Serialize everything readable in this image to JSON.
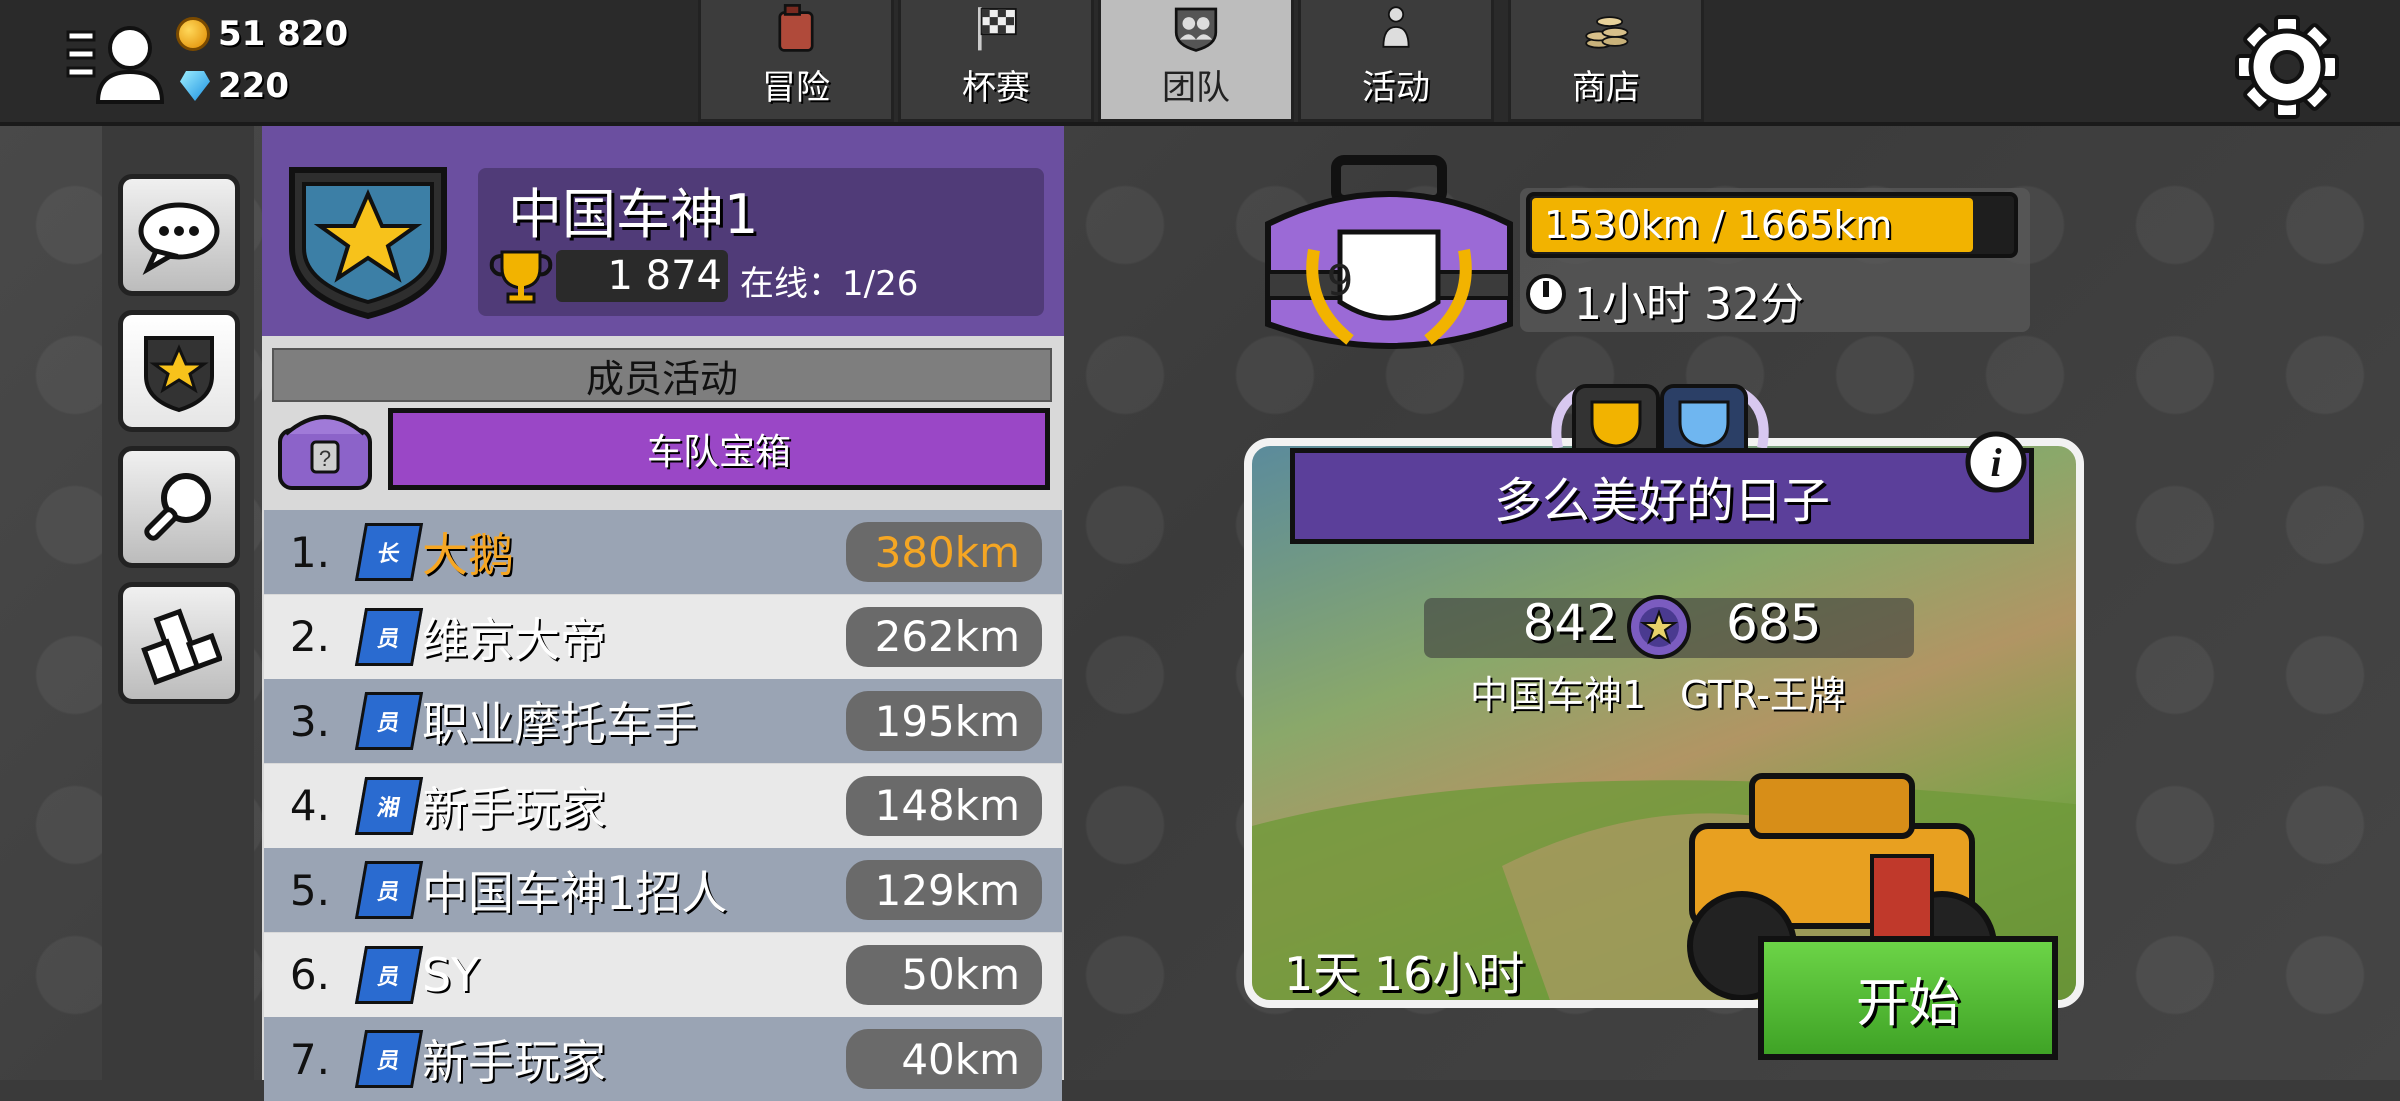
{
  "currency": {
    "coins": "51 820",
    "gems": "220"
  },
  "tabs": [
    {
      "label": "冒险",
      "icon": "fuel-can-icon"
    },
    {
      "label": "杯赛",
      "icon": "checkered-flag-icon"
    },
    {
      "label": "团队",
      "icon": "team-icon",
      "active": true
    },
    {
      "label": "活动",
      "icon": "event-icon"
    },
    {
      "label": "商店",
      "icon": "coins-stack-icon"
    }
  ],
  "team": {
    "name": "中国车神1",
    "trophies": "1 874",
    "online": "在线：1/26"
  },
  "activity": {
    "header": "成员活动",
    "chest_label": "车队宝箱"
  },
  "members": [
    {
      "rank": "1.",
      "badge": "长",
      "name": "大鹅",
      "distance": "380km",
      "highlight": true
    },
    {
      "rank": "2.",
      "badge": "员",
      "name": "维京大帝",
      "distance": "262km"
    },
    {
      "rank": "3.",
      "badge": "员",
      "name": "职业摩托车手",
      "distance": "195km"
    },
    {
      "rank": "4.",
      "badge": "湘",
      "name": "新手玩家",
      "distance": "148km"
    },
    {
      "rank": "5.",
      "badge": "员",
      "name": "中国车神1招人",
      "distance": "129km"
    },
    {
      "rank": "6.",
      "badge": "员",
      "name": "SY",
      "distance": "50km"
    },
    {
      "rank": "7.",
      "badge": "员",
      "name": "新手玩家",
      "distance": "40km"
    }
  ],
  "chest": {
    "level": "9",
    "progress_text": "1530km / 1665km",
    "progress_fraction": 0.919,
    "timer": "1小时 32分"
  },
  "event": {
    "title": "多么美好的日子",
    "score_left": "842",
    "score_right": "685",
    "team_left": "中国车神1",
    "team_right": "GTR-王牌",
    "time_left": "1天 16小时",
    "start_label": "开始"
  },
  "colors": {
    "accent_purple": "#6b4fa0",
    "progress_yellow": "#f2b300",
    "highlight_orange": "#f5a623",
    "start_green": "#4fb52e"
  }
}
